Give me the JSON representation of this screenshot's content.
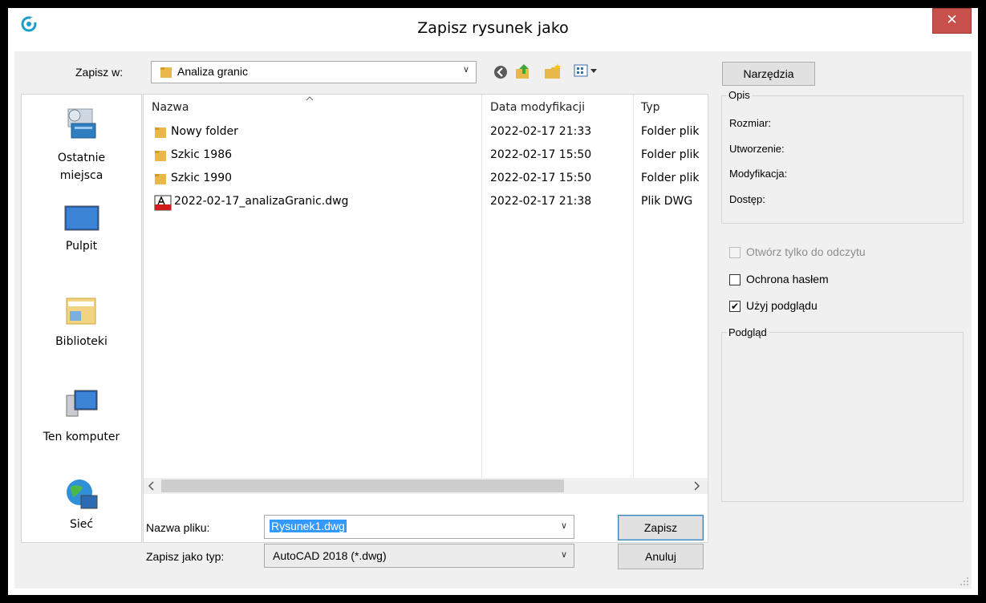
{
  "window": {
    "title": "Zapisz rysunek jako",
    "close_glyph": "✕"
  },
  "toolbar": {
    "save_in_label": "Zapisz w:",
    "save_in_value": "Analiza granic",
    "tools_button": "Narzędzia"
  },
  "places": [
    {
      "label": "Ostatnie\nmiejsca",
      "icon": "recent-places-icon"
    },
    {
      "label": "Pulpit",
      "icon": "desktop-icon"
    },
    {
      "label": "Biblioteki",
      "icon": "libraries-icon"
    },
    {
      "label": "Ten komputer",
      "icon": "computer-icon"
    },
    {
      "label": "Sieć",
      "icon": "network-icon"
    }
  ],
  "list": {
    "columns": [
      "Nazwa",
      "Data modyfikacji",
      "Typ"
    ],
    "rows": [
      {
        "name": "Nowy folder",
        "date": "2022-02-17 21:33",
        "type": "Folder plik",
        "icon": "folder-icon"
      },
      {
        "name": "Szkic 1986",
        "date": "2022-02-17 15:50",
        "type": "Folder plik",
        "icon": "folder-icon"
      },
      {
        "name": "Szkic 1990",
        "date": "2022-02-17 15:50",
        "type": "Folder plik",
        "icon": "folder-icon"
      },
      {
        "name": "2022-02-17_analizaGranic.dwg",
        "date": "2022-02-17 21:38",
        "type": "Plik DWG",
        "icon": "dwg-file-icon"
      }
    ]
  },
  "form": {
    "filename_label": "Nazwa pliku:",
    "filename_value": "Rysunek1.dwg",
    "type_label": "Zapisz jako typ:",
    "type_value": "AutoCAD 2018 (*.dwg)",
    "save_button": "Zapisz",
    "cancel_button": "Anuluj"
  },
  "info": {
    "group_label": "Opis",
    "size_label": "Rozmiar:",
    "created_label": "Utworzenie:",
    "modified_label": "Modyfikacja:",
    "access_label": "Dostęp:"
  },
  "options": {
    "readonly_label": "Otwórz tylko do odczytu",
    "readonly_checked": false,
    "password_label": "Ochrona hasłem",
    "password_checked": false,
    "preview_label": "Użyj podglądu",
    "preview_checked": true
  },
  "preview": {
    "label": "Podgląd"
  },
  "colors": {
    "accent": "#3399ff",
    "close": "#c7504a",
    "folder": "#e8b84a"
  }
}
